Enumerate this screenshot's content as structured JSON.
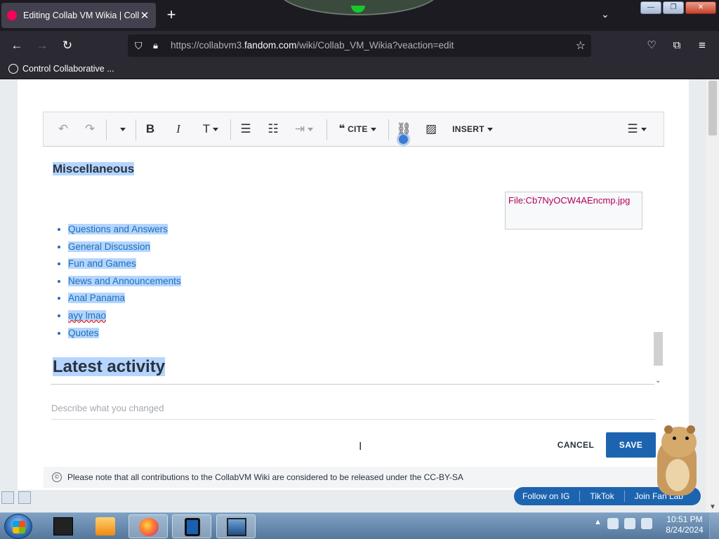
{
  "browser": {
    "tab_title": "Editing Collab VM Wikia | Collab",
    "close_tab": "✕",
    "new_tab": "+",
    "list_tabs": "⌄",
    "url_prefix": "https://collabvm3.",
    "url_domain": "fandom.com",
    "url_path": "/wiki/Collab_VM_Wikia?veaction=edit",
    "bookmark": "Control Collaborative ...",
    "window_minimize": "—",
    "window_restore": "❐",
    "window_close": "✕"
  },
  "toolbar": {
    "cite": "CITE",
    "insert": "INSERT"
  },
  "editor": {
    "heading_misc": "Miscellaneous",
    "file_link": "File:Cb7NyOCW4AEncmp.jpg",
    "links": [
      "Questions and Answers",
      "General Discussion",
      "Fun and Games",
      "News and Announcements",
      "Anal Panama",
      "ayy lmao",
      "Quotes"
    ],
    "heading_latest": "Latest activity"
  },
  "summary_placeholder": "Describe what you changed",
  "buttons": {
    "cancel": "CANCEL",
    "save": "SAVE"
  },
  "license_text": "Please note that all contributions to the CollabVM Wiki are considered to be released under the CC-BY-SA",
  "fan_bar": {
    "follow_ig": "Follow on IG",
    "tiktok": "TikTok",
    "join": "Join Fan Lab"
  },
  "clock": {
    "time": "10:51 PM",
    "date": "8/24/2024"
  },
  "colors": {
    "link": "#1e6fb8",
    "selection": "#b4d5fe",
    "save": "#1d64b0",
    "file": "#b0005e"
  }
}
